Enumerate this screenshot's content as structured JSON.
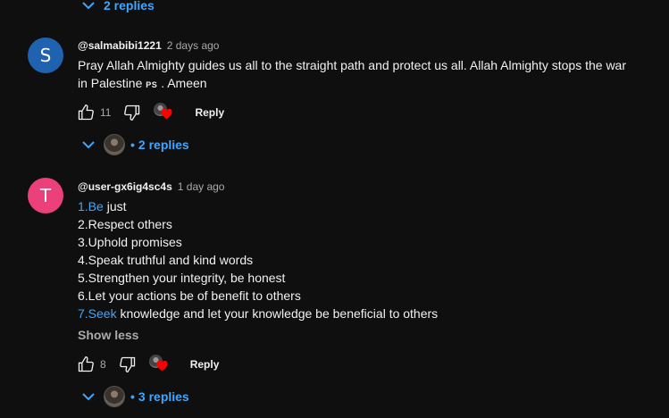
{
  "top_replies": {
    "label": "2 replies"
  },
  "comments": [
    {
      "avatar_letter": "S",
      "avatar_color": "#1f62b0",
      "author": "@salmabibi1221",
      "time": "2 days ago",
      "lines": [
        "Pray Allah Almighty guides us all to the straight path and protect us all. Allah Almighty stops the war",
        "in Palestine",
        "PS",
        ". Ameen"
      ],
      "likes": "11",
      "reply_label": "Reply",
      "replies_label": "2 replies"
    },
    {
      "avatar_letter": "T",
      "avatar_color": "#ec407a",
      "author": "@user-gx6ig4sc4s",
      "time": "1 day ago",
      "list": [
        {
          "link": "1.Be",
          "text": " just"
        },
        {
          "link": "",
          "text": "2.Respect others"
        },
        {
          "link": "",
          "text": "3.Uphold promises"
        },
        {
          "link": "",
          "text": "4.Speak truthful and kind words"
        },
        {
          "link": "",
          "text": "5.Strengthen your integrity, be honest"
        },
        {
          "link": "",
          "text": "6.Let your actions be of benefit to others"
        },
        {
          "link": "7.Seek",
          "text": " knowledge and let your knowledge be beneficial to others"
        }
      ],
      "show_less": "Show less",
      "likes": "8",
      "reply_label": "Reply",
      "replies_label": "3 replies"
    }
  ],
  "accent_color": "#3ea6ff",
  "icons": [
    "chevron-down-icon",
    "like-icon",
    "dislike-icon",
    "creator-heart-icon"
  ]
}
